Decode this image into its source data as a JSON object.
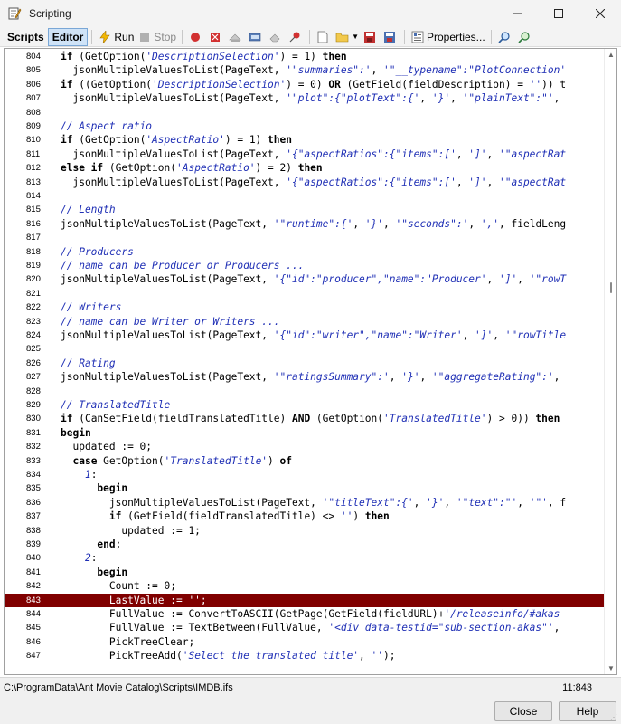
{
  "window": {
    "title": "Scripting",
    "minimize_icon": "minimize-icon",
    "maximize_icon": "maximize-icon",
    "close_icon": "close-icon"
  },
  "toolbar": {
    "tabs": [
      {
        "label": "Scripts",
        "active": false
      },
      {
        "label": "Editor",
        "active": true
      }
    ],
    "run_label": "Run",
    "stop_label": "Stop",
    "properties_label": "Properties..."
  },
  "editor": {
    "lines": [
      {
        "n": "804",
        "html": "<span class=\"kw\">if</span> (GetOption(<span class=\"str\">'DescriptionSelection'</span>) = 1) <span class=\"kw\">then</span>"
      },
      {
        "n": "805",
        "html": "  jsonMultipleValuesToList(PageText, <span class=\"str\">'\"summaries\":'</span>, <span class=\"str\">'\"__typename\":\"PlotConnection'</span>"
      },
      {
        "n": "806",
        "html": "<span class=\"kw\">if</span> ((GetOption(<span class=\"str\">'DescriptionSelection'</span>) = 0) <span class=\"kw\">OR</span> (GetField(fieldDescription) = <span class=\"str\">''</span>)) t"
      },
      {
        "n": "807",
        "html": "  jsonMultipleValuesToList(PageText, <span class=\"str\">'\"plot\":{\"plotText\":{'</span>, <span class=\"str\">'}'</span>, <span class=\"str\">'\"plainText\":\"'</span>,"
      },
      {
        "n": "808",
        "html": ""
      },
      {
        "n": "809",
        "html": "<span class=\"cm\">// Aspect ratio</span>"
      },
      {
        "n": "810",
        "html": "<span class=\"kw\">if</span> (GetOption(<span class=\"str\">'AspectRatio'</span>) = 1) <span class=\"kw\">then</span>"
      },
      {
        "n": "811",
        "html": "  jsonMultipleValuesToList(PageText, <span class=\"str\">'{\"aspectRatios\":{\"items\":['</span>, <span class=\"str\">']'</span>, <span class=\"str\">'\"aspectRat</span>"
      },
      {
        "n": "812",
        "html": "<span class=\"kw\">else if</span> (GetOption(<span class=\"str\">'AspectRatio'</span>) = 2) <span class=\"kw\">then</span>"
      },
      {
        "n": "813",
        "html": "  jsonMultipleValuesToList(PageText, <span class=\"str\">'{\"aspectRatios\":{\"items\":['</span>, <span class=\"str\">']'</span>, <span class=\"str\">'\"aspectRat</span>"
      },
      {
        "n": "814",
        "html": ""
      },
      {
        "n": "815",
        "html": "<span class=\"cm\">// Length</span>"
      },
      {
        "n": "816",
        "html": "jsonMultipleValuesToList(PageText, <span class=\"str\">'\"runtime\":{'</span>, <span class=\"str\">'}'</span>, <span class=\"str\">'\"seconds\":'</span>, <span class=\"str\">','</span>, fieldLeng"
      },
      {
        "n": "817",
        "html": ""
      },
      {
        "n": "818",
        "html": "<span class=\"cm\">// Producers</span>"
      },
      {
        "n": "819",
        "html": "<span class=\"cm\">// name can be Producer or Producers ...</span>"
      },
      {
        "n": "820",
        "html": "jsonMultipleValuesToList(PageText, <span class=\"str\">'{\"id\":\"producer\",\"name\":\"Producer'</span>, <span class=\"str\">']'</span>, <span class=\"str\">'\"rowT</span>"
      },
      {
        "n": "821",
        "html": ""
      },
      {
        "n": "822",
        "html": "<span class=\"cm\">// Writers</span>"
      },
      {
        "n": "823",
        "html": "<span class=\"cm\">// name can be Writer or Writers ...</span>"
      },
      {
        "n": "824",
        "html": "jsonMultipleValuesToList(PageText, <span class=\"str\">'{\"id\":\"writer\",\"name\":\"Writer'</span>, <span class=\"str\">']'</span>, <span class=\"str\">'\"rowTitle</span>"
      },
      {
        "n": "825",
        "html": ""
      },
      {
        "n": "826",
        "html": "<span class=\"cm\">// Rating</span>"
      },
      {
        "n": "827",
        "html": "jsonMultipleValuesToList(PageText, <span class=\"str\">'\"ratingsSummary\":'</span>, <span class=\"str\">'}'</span>, <span class=\"str\">'\"aggregateRating\":'</span>,"
      },
      {
        "n": "828",
        "html": ""
      },
      {
        "n": "829",
        "html": "<span class=\"cm\">// TranslatedTitle</span>"
      },
      {
        "n": "830",
        "html": "<span class=\"kw\">if</span> (CanSetField(fieldTranslatedTitle) <span class=\"kw\">AND</span> (GetOption(<span class=\"str\">'TranslatedTitle'</span>) &gt; 0)) <span class=\"kw\">then</span>"
      },
      {
        "n": "831",
        "html": "<span class=\"kw\">begin</span>"
      },
      {
        "n": "832",
        "html": "  updated := 0;"
      },
      {
        "n": "833",
        "html": "  <span class=\"kw\">case</span> GetOption(<span class=\"str\">'TranslatedTitle'</span>) <span class=\"kw\">of</span>"
      },
      {
        "n": "834",
        "html": "    <span class=\"str\">1</span>:"
      },
      {
        "n": "835",
        "html": "      <span class=\"kw\">begin</span>"
      },
      {
        "n": "836",
        "html": "        jsonMultipleValuesToList(PageText, <span class=\"str\">'\"titleText\":{'</span>, <span class=\"str\">'}'</span>, <span class=\"str\">'\"text\":\"'</span>, <span class=\"str\">'\"'</span>, f"
      },
      {
        "n": "837",
        "html": "        <span class=\"kw\">if</span> (GetField(fieldTranslatedTitle) &lt;&gt; <span class=\"str\">''</span>) <span class=\"kw\">then</span>"
      },
      {
        "n": "838",
        "html": "          updated := 1;"
      },
      {
        "n": "839",
        "html": "      <span class=\"kw\">end</span>;"
      },
      {
        "n": "840",
        "html": "    <span class=\"str\">2</span>:"
      },
      {
        "n": "841",
        "html": "      <span class=\"kw\">begin</span>"
      },
      {
        "n": "842",
        "html": "        Count := 0;"
      },
      {
        "n": "843",
        "html": "        LastValue := '';",
        "highlight": true
      },
      {
        "n": "844",
        "html": "        FullValue := ConvertToASCII(GetPage(GetField(fieldURL)+<span class=\"str\">'/releaseinfo/#akas</span>"
      },
      {
        "n": "845",
        "html": "        FullValue := TextBetween(FullValue, <span class=\"str\">'&lt;div data-testid=\"sub-section-akas\"'</span>,"
      },
      {
        "n": "846",
        "html": "        PickTreeClear;"
      },
      {
        "n": "847",
        "html": "        PickTreeAdd(<span class=\"str\">'Select the translated title'</span>, <span class=\"str\">''</span>);"
      }
    ]
  },
  "status": {
    "path": "C:\\ProgramData\\Ant Movie Catalog\\Scripts\\IMDB.ifs",
    "position": "11:843"
  },
  "buttons": {
    "close_label": "Close",
    "help_label": "Help"
  }
}
